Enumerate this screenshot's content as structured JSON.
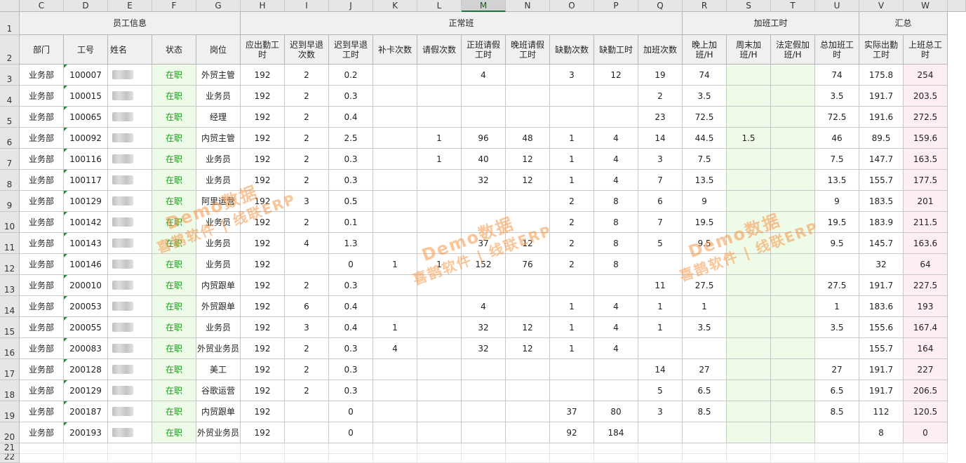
{
  "column_letters": [
    "C",
    "D",
    "E",
    "F",
    "G",
    "H",
    "I",
    "J",
    "K",
    "L",
    "M",
    "N",
    "O",
    "P",
    "Q",
    "R",
    "S",
    "T",
    "U",
    "V",
    "W"
  ],
  "selected_column": "M",
  "row_numbers": [
    "1",
    "2",
    "3",
    "4",
    "5",
    "6",
    "7",
    "8",
    "9",
    "10",
    "11",
    "12",
    "13",
    "14",
    "15",
    "16",
    "17",
    "18",
    "19",
    "20",
    "21",
    "22"
  ],
  "groups": {
    "employee_info": "员工信息",
    "normal_shift": "正常班",
    "overtime_hours": "加班工时",
    "summary": "汇总"
  },
  "headers": [
    "部门",
    "工号",
    "姓名",
    "状态",
    "岗位",
    "应出勤工时",
    "迟到早退次数",
    "迟到早退工时",
    "补卡次数",
    "请假次数",
    "正班请假工时",
    "晚班请假工时",
    "缺勤次数",
    "缺勤工时",
    "加班次数",
    "晚上加班/H",
    "周末加班/H",
    "法定假加班/H",
    "总加班工时",
    "实际出勤工时",
    "上班总工时"
  ],
  "rows": [
    [
      "业务部",
      "100007",
      "",
      "在职",
      "外贸主管",
      "192",
      "2",
      "0.2",
      "",
      "",
      "4",
      "",
      "3",
      "12",
      "19",
      "74",
      "",
      "",
      "74",
      "175.8",
      "254"
    ],
    [
      "业务部",
      "100015",
      "",
      "在职",
      "业务员",
      "192",
      "2",
      "0.3",
      "",
      "",
      "",
      "",
      "",
      "",
      "2",
      "3.5",
      "",
      "",
      "3.5",
      "191.7",
      "203.5"
    ],
    [
      "业务部",
      "100065",
      "",
      "在职",
      "经理",
      "192",
      "2",
      "0.4",
      "",
      "",
      "",
      "",
      "",
      "",
      "23",
      "72.5",
      "",
      "",
      "72.5",
      "191.6",
      "272.5"
    ],
    [
      "业务部",
      "100092",
      "",
      "在职",
      "内贸主管",
      "192",
      "2",
      "2.5",
      "",
      "1",
      "96",
      "48",
      "1",
      "4",
      "14",
      "44.5",
      "1.5",
      "",
      "46",
      "89.5",
      "159.6"
    ],
    [
      "业务部",
      "100116",
      "",
      "在职",
      "业务员",
      "192",
      "2",
      "0.3",
      "",
      "1",
      "40",
      "12",
      "1",
      "4",
      "3",
      "7.5",
      "",
      "",
      "7.5",
      "147.7",
      "163.5"
    ],
    [
      "业务部",
      "100117",
      "",
      "在职",
      "业务员",
      "192",
      "2",
      "0.3",
      "",
      "",
      "32",
      "12",
      "1",
      "4",
      "7",
      "13.5",
      "",
      "",
      "13.5",
      "155.7",
      "177.5"
    ],
    [
      "业务部",
      "100129",
      "",
      "在职",
      "阿里运营",
      "192",
      "3",
      "0.5",
      "",
      "",
      "",
      "",
      "2",
      "8",
      "6",
      "9",
      "",
      "",
      "9",
      "183.5",
      "201"
    ],
    [
      "业务部",
      "100142",
      "",
      "在职",
      "业务员",
      "192",
      "2",
      "0.1",
      "",
      "",
      "",
      "",
      "2",
      "8",
      "7",
      "19.5",
      "",
      "",
      "19.5",
      "183.9",
      "211.5"
    ],
    [
      "业务部",
      "100143",
      "",
      "在职",
      "业务员",
      "192",
      "4",
      "1.3",
      "",
      "",
      "37",
      "12",
      "2",
      "8",
      "5",
      "9.5",
      "",
      "",
      "9.5",
      "145.7",
      "163.6"
    ],
    [
      "业务部",
      "100146",
      "",
      "在职",
      "业务员",
      "192",
      "",
      "0",
      "1",
      "1",
      "152",
      "76",
      "2",
      "8",
      "",
      "",
      "",
      "",
      "",
      "32",
      "64"
    ],
    [
      "业务部",
      "200010",
      "",
      "在职",
      "内贸跟单",
      "192",
      "2",
      "0.3",
      "",
      "",
      "",
      "",
      "",
      "",
      "11",
      "27.5",
      "",
      "",
      "27.5",
      "191.7",
      "227.5"
    ],
    [
      "业务部",
      "200053",
      "",
      "在职",
      "外贸跟单",
      "192",
      "6",
      "0.4",
      "",
      "",
      "4",
      "",
      "1",
      "4",
      "1",
      "1",
      "",
      "",
      "1",
      "183.6",
      "193"
    ],
    [
      "业务部",
      "200055",
      "",
      "在职",
      "业务员",
      "192",
      "3",
      "0.4",
      "1",
      "",
      "32",
      "12",
      "1",
      "4",
      "1",
      "3.5",
      "",
      "",
      "3.5",
      "155.6",
      "167.4"
    ],
    [
      "业务部",
      "200083",
      "",
      "在职",
      "外贸业务员",
      "192",
      "2",
      "0.3",
      "4",
      "",
      "32",
      "12",
      "1",
      "4",
      "",
      "",
      "",
      "",
      "",
      "155.7",
      "164"
    ],
    [
      "业务部",
      "200128",
      "",
      "在职",
      "美工",
      "192",
      "2",
      "0.3",
      "",
      "",
      "",
      "",
      "",
      "",
      "14",
      "27",
      "",
      "",
      "27",
      "191.7",
      "227"
    ],
    [
      "业务部",
      "200129",
      "",
      "在职",
      "谷歌运营",
      "192",
      "2",
      "0.3",
      "",
      "",
      "",
      "",
      "",
      "",
      "5",
      "6.5",
      "",
      "",
      "6.5",
      "191.7",
      "206.5"
    ],
    [
      "业务部",
      "200187",
      "",
      "在职",
      "内贸跟单",
      "192",
      "",
      "0",
      "",
      "",
      "",
      "",
      "37",
      "80",
      "3",
      "8.5",
      "",
      "",
      "8.5",
      "112",
      "120.5"
    ],
    [
      "业务部",
      "200193",
      "",
      "在职",
      "外贸业务员",
      "192",
      "",
      "0",
      "",
      "",
      "",
      "",
      "92",
      "184",
      "",
      "",
      "",
      "",
      "",
      "8",
      "0"
    ]
  ],
  "watermark": {
    "line1": "Demo数据",
    "line2": "喜鹊软件 | 线联ERP"
  },
  "colors": {
    "status_text": "#1a9b1a",
    "status_bg": "#eefbe9",
    "overtime_bg": "#effbe9",
    "total_bg": "#fdeef2",
    "header_bg": "#f0f0f0"
  }
}
